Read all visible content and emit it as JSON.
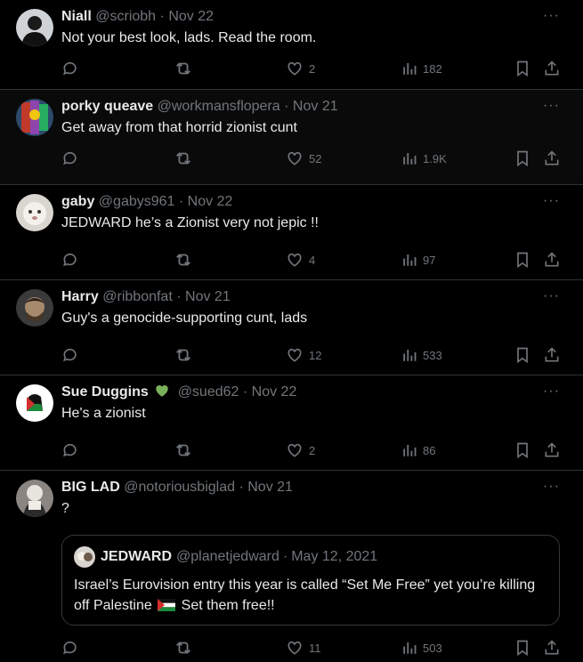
{
  "tweets": [
    {
      "name": "Niall",
      "handle": "@scriobh",
      "date": "Nov 22",
      "text": "Not your best look, lads. Read the room.",
      "likes": "2",
      "views": "182"
    },
    {
      "name": "porky queave",
      "handle": "@workmansflopera",
      "date": "Nov 21",
      "text": "Get away from that horrid zionist cunt",
      "likes": "52",
      "views": "1.9K"
    },
    {
      "name": "gaby",
      "handle": "@gabys961",
      "date": "Nov 22",
      "text": "JEDWARD he’s a Zionist very not jepic !!",
      "likes": "4",
      "views": "97"
    },
    {
      "name": "Harry",
      "handle": "@ribbonfat",
      "date": "Nov 21",
      "text": "Guy's a genocide-supporting cunt, lads",
      "likes": "12",
      "views": "533"
    },
    {
      "name": "Sue Duggins",
      "handle": "@sued62",
      "date": "Nov 22",
      "text": "He's a zionist",
      "likes": "2",
      "views": "86",
      "badge": "green-heart-emoji"
    },
    {
      "name": "BIG LAD",
      "handle": "@notoriousbiglad",
      "date": "Nov 21",
      "text": "?",
      "likes": "11",
      "views": "503"
    }
  ],
  "quote": {
    "name": "JEDWARD",
    "handle": "@planetjedward",
    "date": "May 12, 2021",
    "text_part1": "Israel’s Eurovision entry this year is called “Set Me Free” yet you’re killing off Palestine",
    "text_part2": "Set them free!!",
    "emoji": "palestine-flag-emoji"
  },
  "separator": "·",
  "more_label": "···",
  "colors": {
    "background": "#000000",
    "text": "#e7e9ea",
    "muted": "#71767b",
    "border": "#2f3336",
    "green_heart": "#78b159"
  }
}
